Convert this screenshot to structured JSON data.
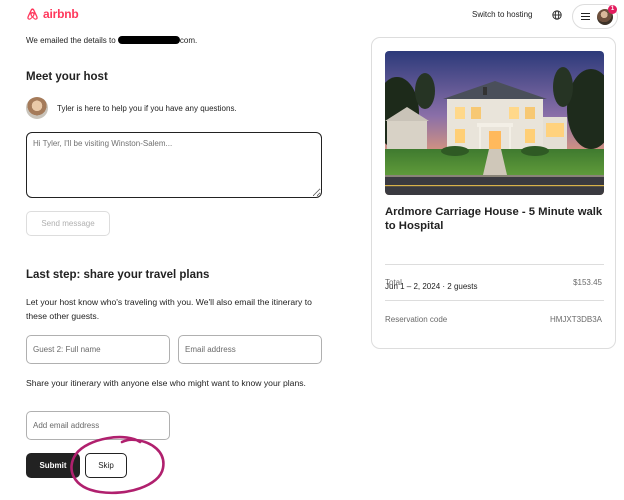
{
  "header": {
    "brand": "airbnb",
    "switch_hosting": "Switch to hosting",
    "notification_count": "1"
  },
  "confirmation": {
    "emailed_prefix": "We emailed the details to ",
    "emailed_suffix": "com."
  },
  "host_section": {
    "title": "Meet your host",
    "help_text": "Tyler is here to help you if you have any questions.",
    "message_placeholder": "Hi Tyler, I'll be visiting Winston-Salem...",
    "send_label": "Send message"
  },
  "travel_section": {
    "title": "Last step: share your travel plans",
    "description": "Let your host know who's traveling with you. We'll also email the itinerary to these other guests.",
    "guest_name_placeholder": "Guest 2: Full name",
    "email_placeholder": "Email address",
    "share_text": "Share your itinerary with anyone else who might want to know your plans.",
    "add_email_placeholder": "Add email address",
    "submit_label": "Submit",
    "skip_label": "Skip"
  },
  "listing": {
    "title": "Ardmore Carriage House - 5 Minute walk to Hospital",
    "dates_guests": "Jun 1 – 2, 2024 · 2 guests",
    "total_label": "Total",
    "total_value": "$153.45",
    "code_label": "Reservation code",
    "code_value": "HMJXT3DB3A"
  },
  "colors": {
    "brand": "#ff385c",
    "dark_button": "#222222",
    "annotation": "#b0206e"
  }
}
